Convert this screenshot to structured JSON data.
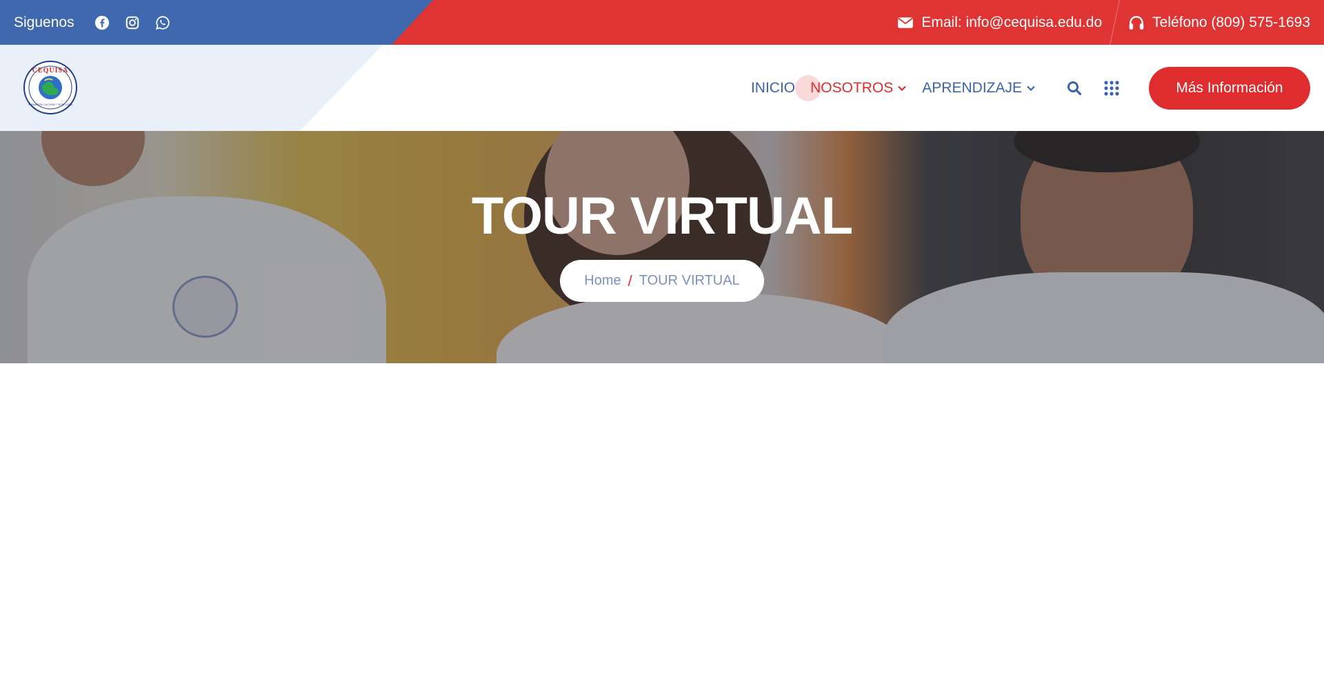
{
  "topbar": {
    "follow_label": "Siguenos",
    "socials": [
      "facebook-icon",
      "instagram-icon",
      "whatsapp-icon"
    ],
    "email_text": "Email: info@cequisa.edu.do",
    "phone_text": "Teléfono (809) 575-1693",
    "colors": {
      "blue": "#3f68ae",
      "red": "#df3434"
    }
  },
  "header": {
    "logo_text": "CEQUISA",
    "logo_motto": "FORMACIÓN, CULTURA Y TECNOLOGÍA",
    "nav": [
      {
        "label": "INICIO",
        "has_dropdown": false,
        "active": false
      },
      {
        "label": "NOSOTROS",
        "has_dropdown": true,
        "active": true
      },
      {
        "label": "APRENDIZAJE",
        "has_dropdown": true,
        "active": false
      }
    ],
    "cta_label": "Más Información",
    "colors": {
      "nav": "#3b63ad",
      "active": "#dd2c2c",
      "cta": "#df2d2f"
    }
  },
  "hero": {
    "title": "TOUR VIRTUAL",
    "breadcrumb": {
      "home": "Home",
      "separator": "/",
      "current": "TOUR VIRTUAL"
    }
  }
}
